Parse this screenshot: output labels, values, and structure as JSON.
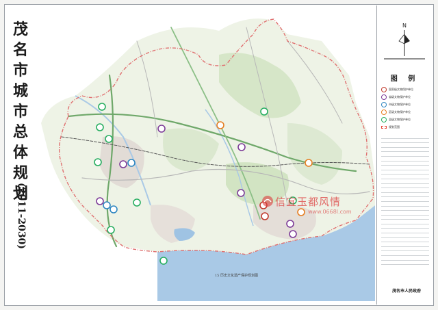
{
  "map": {
    "title_chars": [
      "茂",
      "名",
      "市",
      "城",
      "市",
      "总",
      "体",
      "规",
      "划"
    ],
    "title_years": "(2011-2030)",
    "legend_title": "图 例",
    "legend_items": [
      {
        "label": "国家级文物保护单位",
        "color": "#c0392b"
      },
      {
        "label": "省级文物保护单位",
        "color": "#7d3c98"
      },
      {
        "label": "市级文物保护单位",
        "color": "#2e86c1"
      },
      {
        "label": "区级文物保护单位",
        "color": "#e67e22"
      },
      {
        "label": "县级文物保护单位",
        "color": "#27ae60"
      },
      {
        "label": "规划范围",
        "color": "#e74c3c"
      }
    ],
    "sheet_label": "15 历史文化遗产保护规划图",
    "caption": "茂名市人民政府",
    "compass_letter": "N",
    "watermark_text": "信宜玉都风情",
    "watermark_url": "www.0668l.com"
  }
}
